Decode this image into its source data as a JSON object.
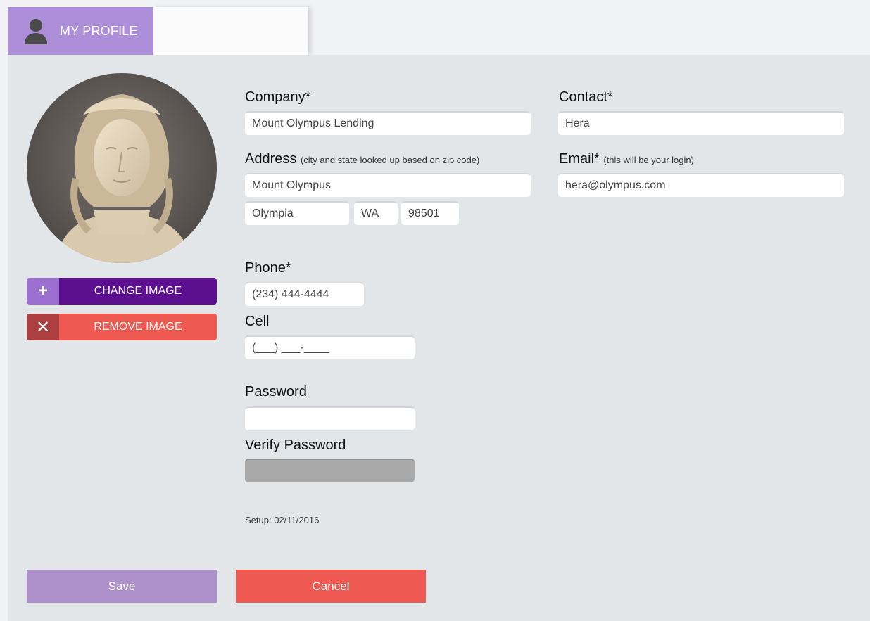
{
  "tabs": {
    "active_label": "MY PROFILE"
  },
  "image_buttons": {
    "change_label": "CHANGE IMAGE",
    "remove_label": "REMOVE IMAGE",
    "change_icon": "plus-icon",
    "remove_icon": "x-icon"
  },
  "form": {
    "company": {
      "label": "Company*",
      "value": "Mount Olympus Lending"
    },
    "contact": {
      "label": "Contact*",
      "value": "Hera"
    },
    "address": {
      "label": "Address",
      "hint": "(city and state looked up based on zip code)",
      "street": "Mount Olympus",
      "city": "Olympia",
      "state": "WA",
      "zip": "98501"
    },
    "email": {
      "label": "Email*",
      "hint": "(this will be your login)",
      "value": "hera@olympus.com"
    },
    "phone": {
      "label": "Phone*",
      "value": "(234) 444-4444"
    },
    "cell": {
      "label": "Cell",
      "value": "(___) ___-____"
    },
    "password": {
      "label": "Password",
      "value": ""
    },
    "verify_password": {
      "label": "Verify Password",
      "value": ""
    }
  },
  "setup": "Setup: 02/11/2016",
  "actions": {
    "save_label": "Save",
    "cancel_label": "Cancel"
  },
  "colors": {
    "accent": "#ad8fd9",
    "primary_dark": "#5c0f8e",
    "danger": "#ee5a52",
    "save_disabled": "#ad8fc9"
  }
}
